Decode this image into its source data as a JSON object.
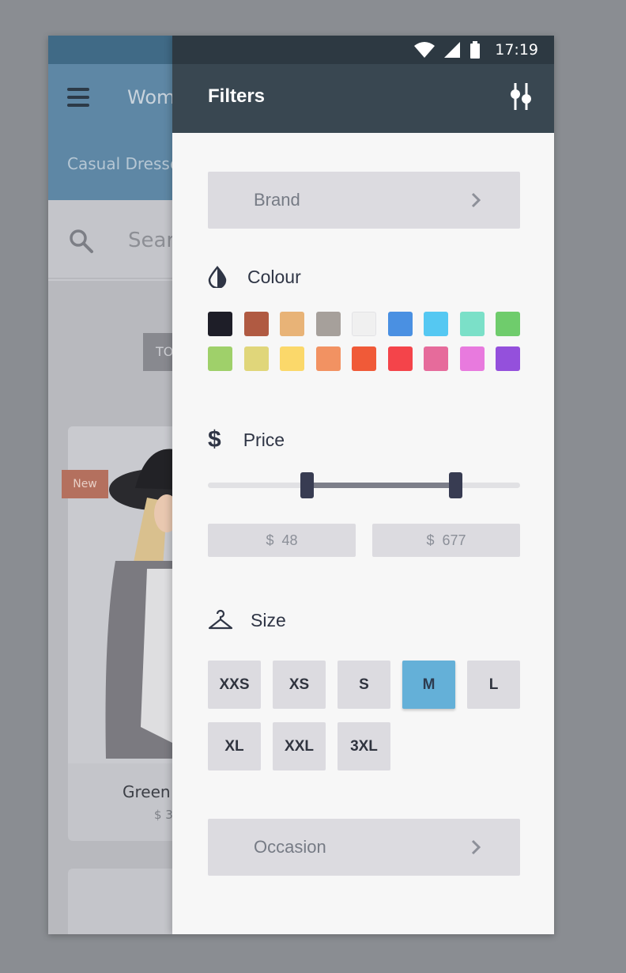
{
  "status_bar": {
    "time": "17:19"
  },
  "background_app": {
    "title": "Wom",
    "subtitle": "Casual Dresse",
    "search_placeholder": "Sear",
    "chip_label": "TO",
    "badge": "New",
    "product_name": "Green",
    "product_price": "$ 3"
  },
  "drawer": {
    "title": "Filters",
    "brand_label": "Brand",
    "colour": {
      "title": "Colour",
      "swatches": [
        "#1e1e28",
        "#b05a42",
        "#e8b377",
        "#a6a09b",
        "#f0f0f0",
        "#4a90e2",
        "#55c8f2",
        "#7be0c8",
        "#6fcc6c",
        "#9fd06a",
        "#e0d67a",
        "#fbd86a",
        "#f29262",
        "#f05a38",
        "#f4444a",
        "#e66b9b",
        "#e87ade",
        "#9450dc"
      ]
    },
    "price": {
      "title": "Price",
      "currency": "$",
      "min_value": "48",
      "max_value": "677"
    },
    "size": {
      "title": "Size",
      "options": [
        "XXS",
        "XS",
        "S",
        "M",
        "L",
        "XL",
        "XXL",
        "3XL"
      ],
      "selected": "M"
    },
    "occasion_label": "Occasion"
  }
}
